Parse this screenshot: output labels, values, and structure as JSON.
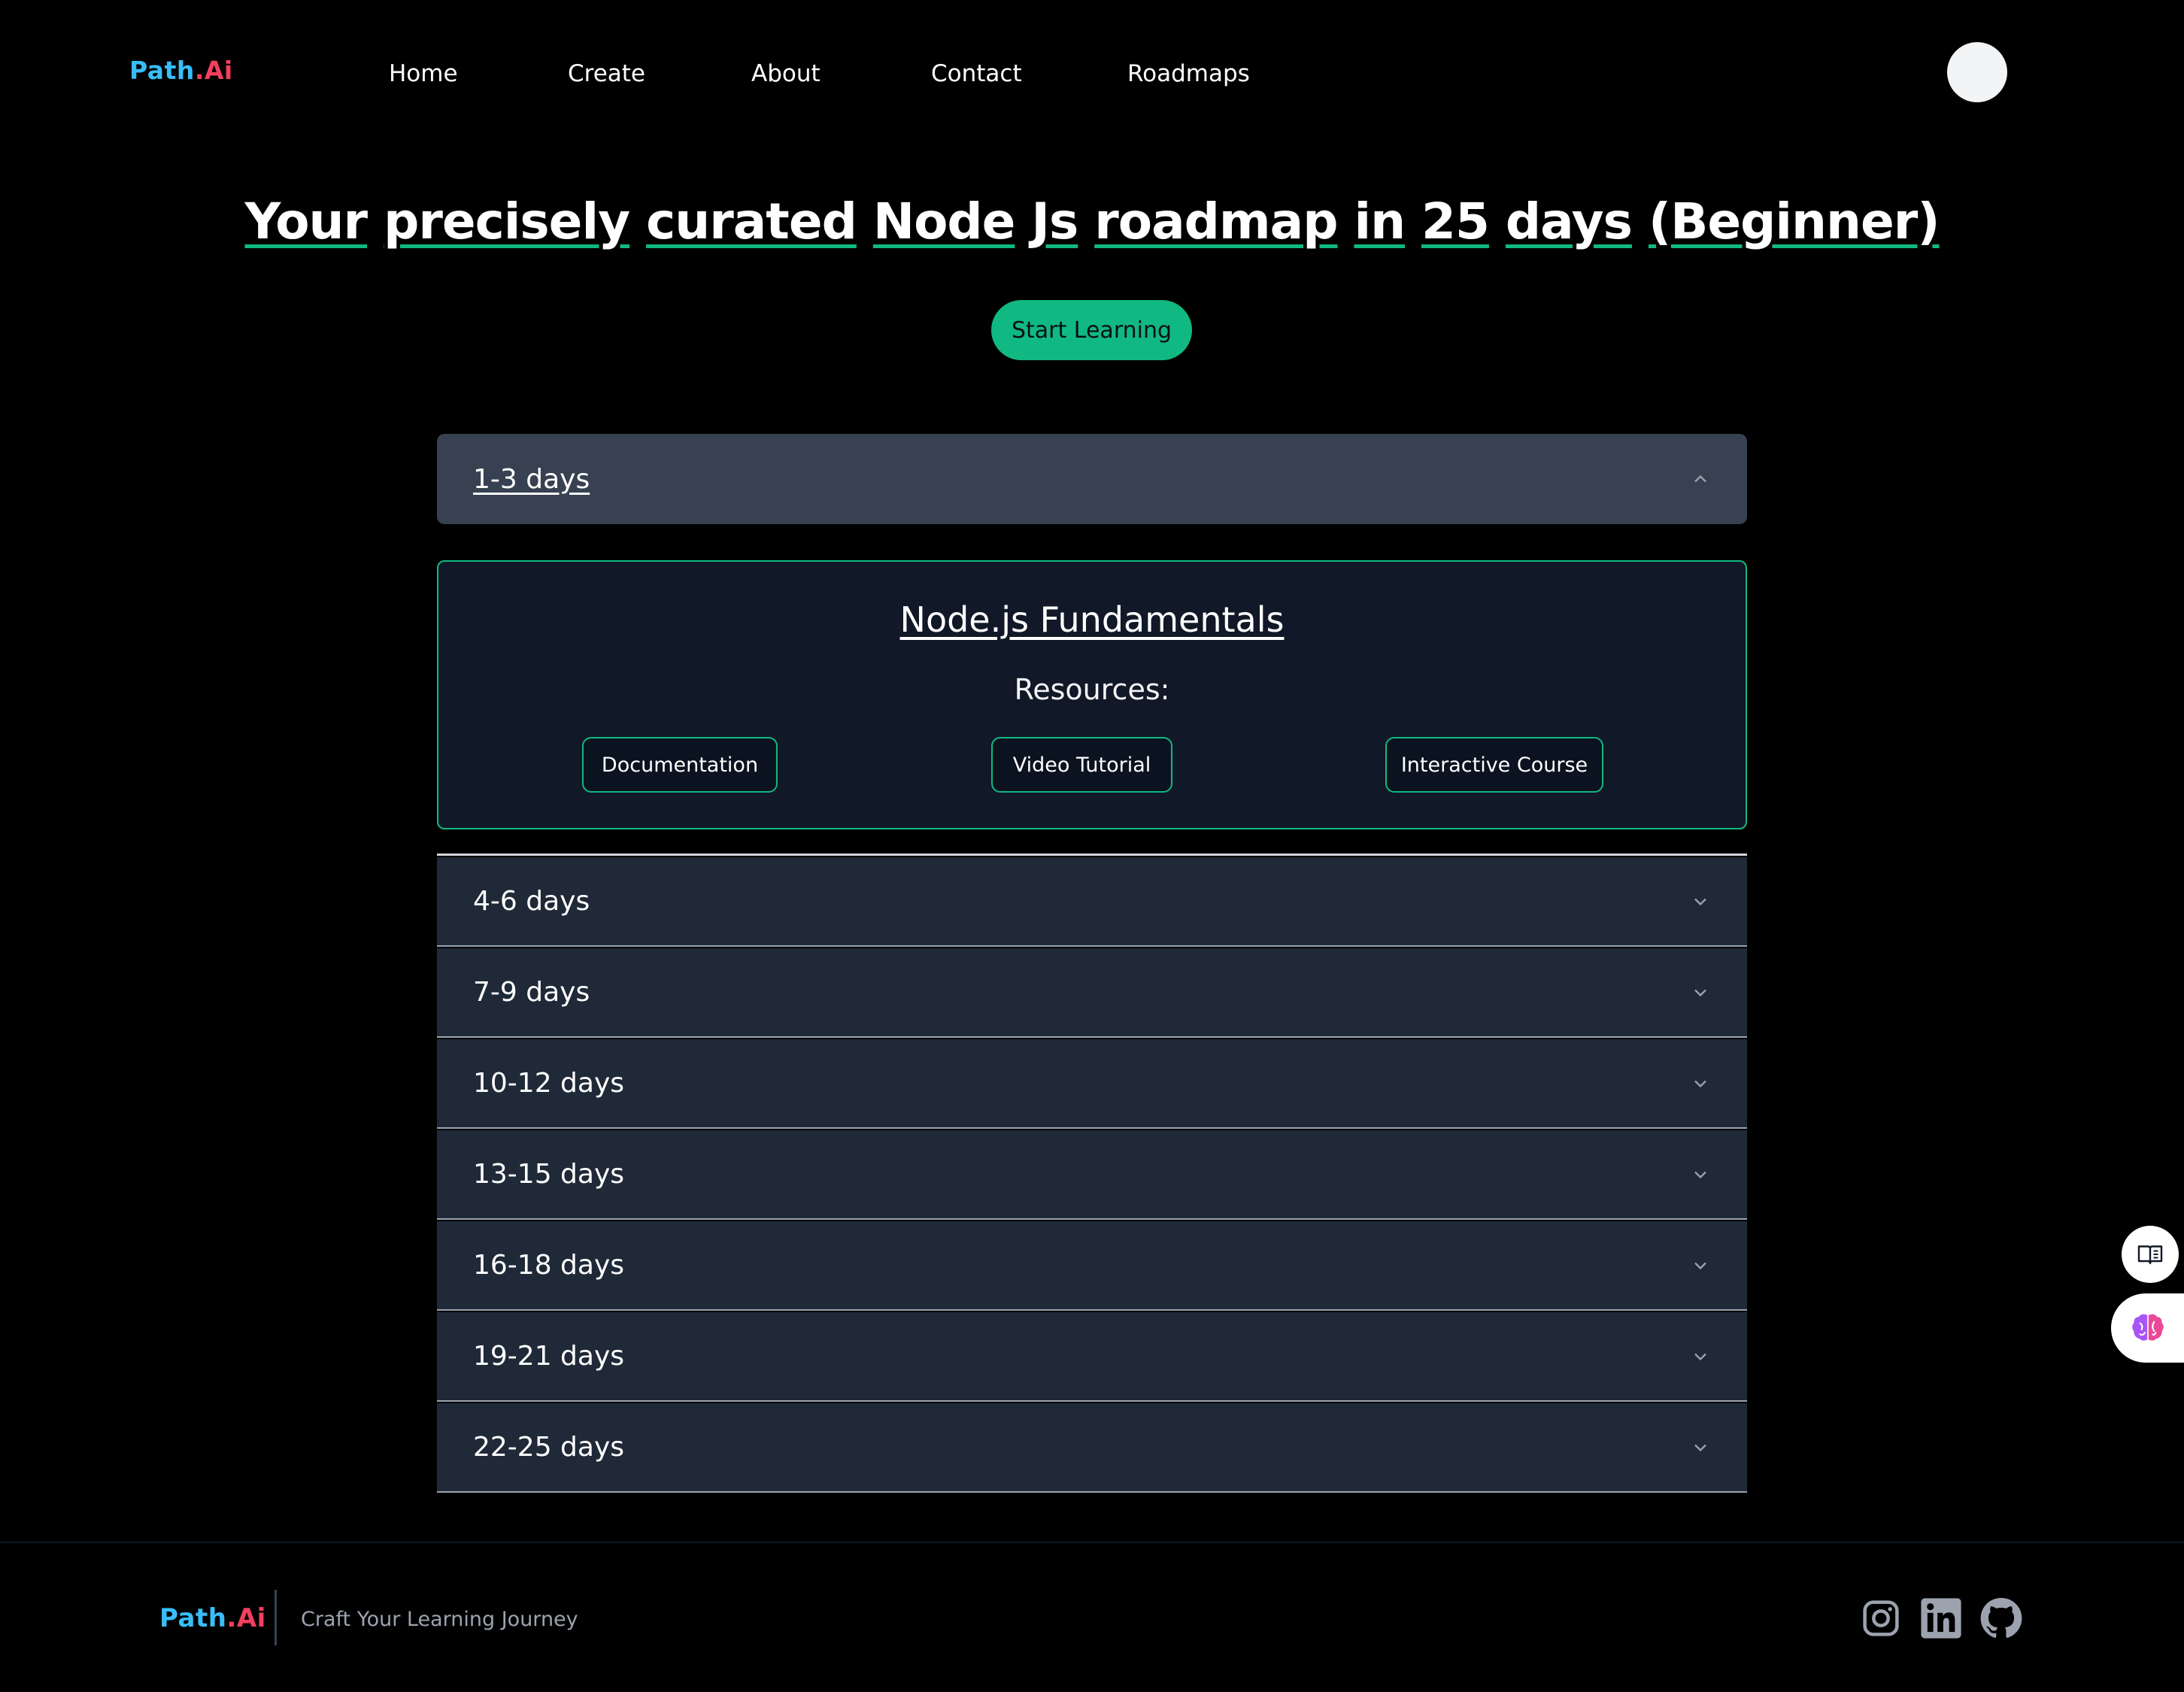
{
  "brand": {
    "name_part1": "Path",
    "name_part2": ".Ai"
  },
  "nav": {
    "links": [
      "Home",
      "Create",
      "About",
      "Contact",
      "Roadmaps"
    ]
  },
  "hero": {
    "title_words": [
      "Your",
      "precisely",
      "curated",
      "Node",
      "Js",
      "roadmap",
      "in",
      "25",
      "days",
      "(Beginner)"
    ],
    "cta_label": "Start Learning"
  },
  "roadmap": {
    "open_section": {
      "label": "1-3 days",
      "topic": "Node.js Fundamentals",
      "resources_heading": "Resources:",
      "resources": [
        "Documentation",
        "Video Tutorial",
        "Interactive Course"
      ]
    },
    "collapsed_sections": [
      "4-6 days",
      "7-9 days",
      "10-12 days",
      "13-15 days",
      "16-18 days",
      "19-21 days",
      "22-25 days"
    ]
  },
  "footer": {
    "tagline": "Craft Your Learning Journey",
    "social_icons": [
      "instagram-icon",
      "linkedin-icon",
      "github-icon"
    ]
  },
  "side_widgets": [
    "book-icon",
    "brain-icon"
  ],
  "colors": {
    "accent": "#10b981",
    "background": "#000000",
    "accordion_open": "#374151",
    "accordion_closed": "#1f2937",
    "panel": "#111827",
    "logo_blue": "#38bdf8",
    "logo_pink": "#f43f5e"
  }
}
